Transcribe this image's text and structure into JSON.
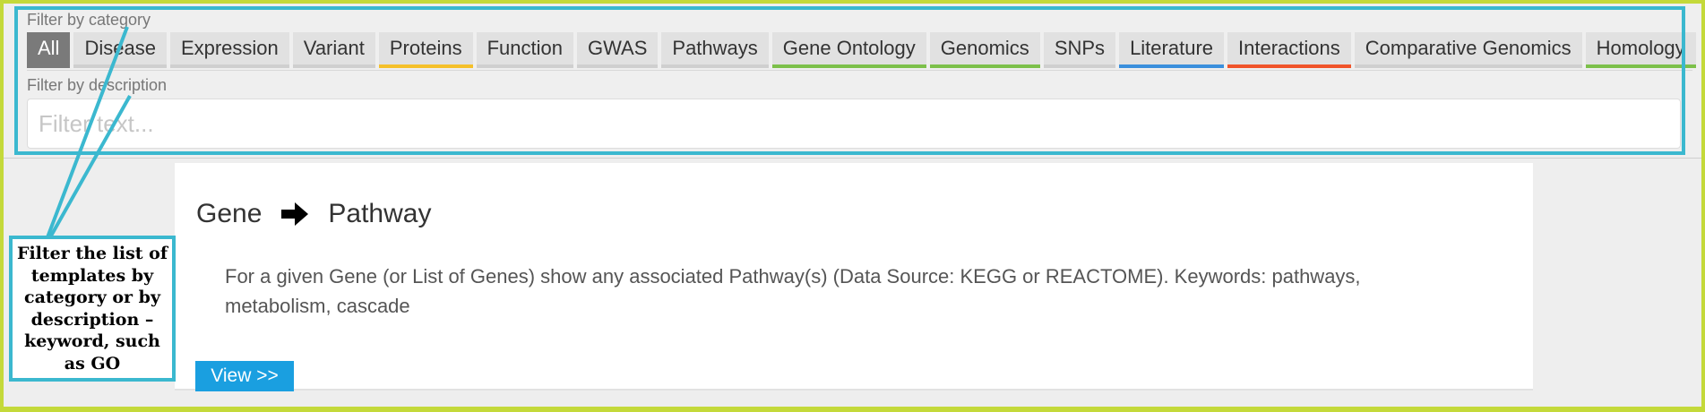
{
  "filter": {
    "category_label": "Filter by category",
    "description_label": "Filter by description",
    "placeholder": "Filter text...",
    "tabs": [
      {
        "label": "All",
        "active": true,
        "accent": null
      },
      {
        "label": "Disease",
        "accent": null
      },
      {
        "label": "Expression",
        "accent": null
      },
      {
        "label": "Variant",
        "accent": null
      },
      {
        "label": "Proteins",
        "accent": "#f5c02a"
      },
      {
        "label": "Function",
        "accent": null
      },
      {
        "label": "GWAS",
        "accent": null
      },
      {
        "label": "Pathways",
        "accent": null
      },
      {
        "label": "Gene Ontology",
        "accent": "#7cc04a"
      },
      {
        "label": "Genomics",
        "accent": "#7cc04a"
      },
      {
        "label": "SNPs",
        "accent": null
      },
      {
        "label": "Literature",
        "accent": "#3a8fdc"
      },
      {
        "label": "Interactions",
        "accent": "#f0542a"
      },
      {
        "label": "Comparative Genomics",
        "accent": null
      },
      {
        "label": "Homology",
        "accent": "#7cc04a"
      }
    ]
  },
  "card": {
    "title_from": "Gene",
    "arrow_icon": "arrow-right-icon",
    "title_to": "Pathway",
    "description": "For a given Gene (or List of Genes) show any associated Pathway(s) (Data Source: KEGG or REACTOME). Keywords: pathways, metabolism, cascade",
    "view_label": "View >>"
  },
  "annotation": {
    "text": "Filter the list of templates by category or by description – keyword, such as GO",
    "color": "#3bb8cf"
  },
  "colors": {
    "background": "#c4d93a",
    "view_button": "#1a9fe0",
    "active_tab": "#7a7a7a"
  }
}
